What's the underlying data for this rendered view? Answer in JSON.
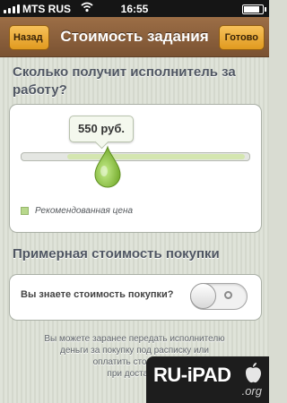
{
  "status_bar": {
    "carrier": "MTS RUS",
    "time": "16:55",
    "battery_level": 0.85
  },
  "navbar": {
    "back_label": "Назад",
    "title": "Стоимость задания",
    "done_label": "Готово"
  },
  "price_section": {
    "header": "Сколько получит исполнитель за работу?",
    "selected_price": "550 руб.",
    "slider_value": 0.38,
    "recommended_range": [
      0.2,
      0.98
    ],
    "legend_label": "Рекомендованная цена",
    "colors": {
      "thumb": "#8fc74a",
      "recommended": "#d4e6b0"
    }
  },
  "purchase_section": {
    "header": "Примерная стоимость покупки",
    "question_label": "Вы знаете стоимость покупки?",
    "toggle_on": false
  },
  "footnote": {
    "lines": [
      "Вы можете заранее передать исполнителю",
      "деньги за покупку под расписку или",
      "оплатить стоимость",
      "при доставке"
    ]
  },
  "watermark": {
    "text": "RU-iPAD",
    "suffix": ".org"
  }
}
